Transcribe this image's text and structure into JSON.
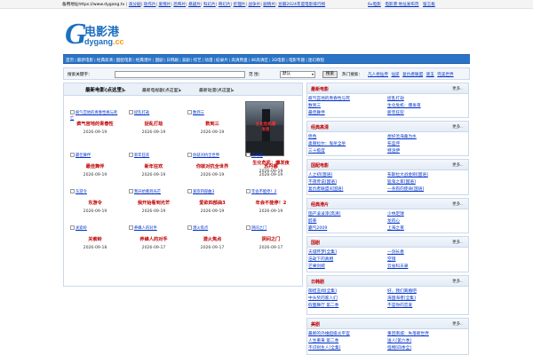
{
  "topbar": {
    "backup_text": "备用地址https://www.dygang.tv",
    "links": [
      "高分剧",
      "动作片",
      "爱情片",
      "恐怖片",
      "悬疑片",
      "科幻片",
      "奇幻片",
      "伦理片",
      "战争片",
      "剧情片",
      "豆瓣2024年度电影排行榜"
    ],
    "right_links": [
      "6v电影",
      "电影港 地址发布页",
      "留言板"
    ]
  },
  "logo": {
    "name": "电影港",
    "domain_left": "dygang",
    "domain_right": ".cc"
  },
  "nav": {
    "items": [
      "首页",
      "最新电影",
      "经典高清",
      "国配电影",
      "经典港片",
      "国剧",
      "日韩剧",
      "美剧",
      "综艺",
      "动漫",
      "纪录片",
      "高清原盘",
      "4K高清区",
      "3D电影",
      "电影专题",
      "迷幻教程"
    ]
  },
  "search": {
    "label": "搜索关键字：",
    "value": "",
    "range_label": "范 围：",
    "range_value": "默认",
    "button": "搜索",
    "hot_label": "热门搜索：",
    "hot_items": [
      "凡人修仙传",
      "仙逆",
      "复仇者联盟",
      "逐玉",
      "完美世界"
    ]
  },
  "main": {
    "tabs": [
      {
        "label": "最新电影(点这里)"
      },
      {
        "label": "最新电视剧(点这里)"
      },
      {
        "label": "最新动漫(点这里)"
      }
    ],
    "cards": [
      {
        "alt": "疯气宫地的青春性格与死亡",
        "title": "疯气宫地的青春性",
        "date": "2026-09-19"
      },
      {
        "alt": "捉乱打劫",
        "title": "捉乱打劫",
        "date": "2026-09-19"
      },
      {
        "alt": "数到三",
        "title": "数到三",
        "date": "2026-09-19"
      },
      {
        "alt": "",
        "title": "生化危机：爆发夜",
        "date": "2026-09-19",
        "poster_text": "生化危机爆发夜"
      },
      {
        "alt": "最佳舞伴",
        "title": "最佳舞伴",
        "date": "2026-09-19"
      },
      {
        "alt": "新年狂欢",
        "title": "新年狂欢",
        "date": "2026-09-19"
      },
      {
        "alt": "你就对抗全世界",
        "title": "你就对抗全世界",
        "date": "2026-09-19"
      },
      {
        "alt": "苏丹娜",
        "title": "苏丹娜",
        "date": "2026-09-19"
      },
      {
        "alt": "东游令",
        "title": "东游令",
        "date": "2026-09-19"
      },
      {
        "alt": "我开始看到光芒",
        "title": "我开始看到光芒",
        "date": "2026-09-19"
      },
      {
        "alt": "爱欲四部曲3",
        "title": "爱欲四部曲3",
        "date": "2026-09-19"
      },
      {
        "alt": "年会不能停！2",
        "title": "年会不能停！2",
        "date": "2026-09-19"
      },
      {
        "alt": "关索岭",
        "title": "关索岭",
        "date": "2026-09-18"
      },
      {
        "alt": "养蜂人的对手",
        "title": "养蜂人的对手",
        "date": "2026-09-17"
      },
      {
        "alt": "潜火焦点",
        "title": "潜火焦点",
        "date": "2026-09-17"
      },
      {
        "alt": "阴间之门",
        "title": "阴间之门",
        "date": "2026-09-17"
      }
    ]
  },
  "sidebar": {
    "more_label": "更多..",
    "sections": [
      {
        "title": "最新电影",
        "items": [
          "疯气宫地的青春性与死",
          "数到三",
          "最佳舞伴",
          "捉乱打劫",
          "生化危机：爆发夜",
          "新年狂欢"
        ]
      },
      {
        "title": "经典高清",
        "items": [
          "债色",
          "奥丽拉尔：鬼杀全杀",
          "三十极度",
          "想好沧海桑为水",
          "布蓝坪",
          "特洛伊"
        ]
      },
      {
        "title": "国配电影",
        "items": [
          "人之初[国语]",
          "不夜传说[国语]",
          "复仇者联盟4[国语]",
          "布斯拉大战金刚[国语]",
          "猛鬼之家[国语]",
          "一条狗的使命[国语]"
        ]
      },
      {
        "title": "经典港片",
        "items": [
          "国产凌凌漆[高清]",
          "醉拳",
          "霸气2009",
          "少林足球",
          "龙的心",
          "上海之夜"
        ]
      },
      {
        "title": "国剧",
        "items": [
          "天城怀梦[全集]",
          "浩劫下的真相",
          "芒果剑婉",
          "一剑长春",
          "空镜",
          "云省科天录"
        ]
      },
      {
        "title": "日韩剧",
        "items": [
          "御结丑闻[全集]",
          "中头奖的家人们",
          "假面舞厅 第二季",
          "好，我们离婚吧",
          "海国海者[全集]",
          "不是你的恋爱"
        ]
      },
      {
        "title": "美剧",
        "items": [
          "最新的外维超级炎平官",
          "人生重来 第二季",
          "不识别生人[全集]",
          "重回南城：失落新世界",
          "送人[第六季]",
          "怪物[四季全]"
        ]
      }
    ]
  }
}
